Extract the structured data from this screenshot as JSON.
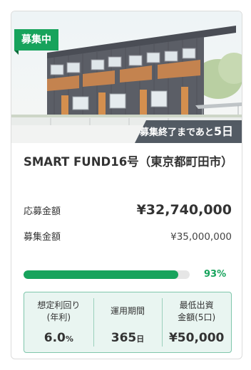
{
  "card": {
    "status_badge": "募集中",
    "deadline": {
      "prefix": "募集終了まであと",
      "days": "5日"
    },
    "title": "SMART FUND16号（東京都町田市）",
    "applied": {
      "label": "応募金額",
      "value": "¥32,740,000"
    },
    "target": {
      "label": "募集金額",
      "value": "¥35,000,000"
    },
    "progress": {
      "percent": 93,
      "label": "93%"
    },
    "terms": [
      {
        "label_line1": "想定利回り",
        "label_line2": "(年利)",
        "value": "6.0",
        "unit": "%"
      },
      {
        "label_line1": "運用期間",
        "label_line2": "",
        "value": "365",
        "unit": "日"
      },
      {
        "label_line1": "最低出資",
        "label_line2": "金額(5口)",
        "value": "¥50,000",
        "unit": ""
      }
    ]
  },
  "colors": {
    "accent_green": "#17a35c",
    "ribbon_bg": "#3c4650",
    "terms_bg": "#e9f5f1",
    "terms_border": "#7fc6ab"
  },
  "icons": {
    "photo": "apartment-building-image"
  }
}
